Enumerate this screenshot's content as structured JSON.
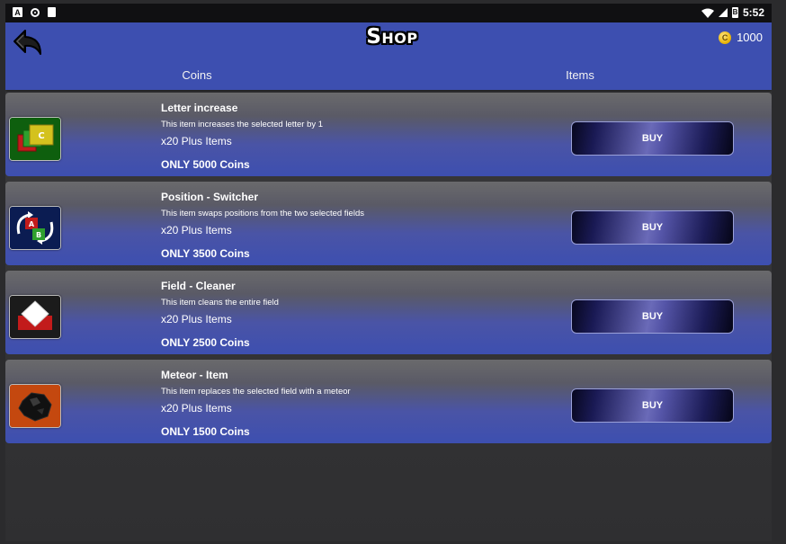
{
  "status_bar": {
    "time": "5:52",
    "notification_a": "A",
    "battery": "B"
  },
  "header": {
    "title": "Shop",
    "coins": "1000",
    "coin_symbol": "C"
  },
  "tabs": [
    {
      "label": "Coins"
    },
    {
      "label": "Items"
    }
  ],
  "items": [
    {
      "title": "Letter increase",
      "description": "This item increases the selected letter by 1",
      "quantity": "x20 Plus Items",
      "price": "ONLY 5000 Coins",
      "buy_label": "BUY",
      "icon": "letter-increase-icon",
      "icon_letter": "C"
    },
    {
      "title": "Position - Switcher",
      "description": "This item swaps positions from the two selected fields",
      "quantity": "x20 Plus Items",
      "price": "ONLY 3500 Coins",
      "buy_label": "BUY",
      "icon": "position-switch-icon",
      "icon_letter_a": "A",
      "icon_letter_b": "B"
    },
    {
      "title": "Field - Cleaner",
      "description": "This item cleans the entire field",
      "quantity": "x20 Plus Items",
      "price": "ONLY 2500 Coins",
      "buy_label": "BUY",
      "icon": "eraser-icon"
    },
    {
      "title": "Meteor - Item",
      "description": "This item replaces the selected field with a meteor",
      "quantity": "x20 Plus Items",
      "price": "ONLY 1500 Coins",
      "buy_label": "BUY",
      "icon": "meteor-icon"
    }
  ],
  "colors": {
    "header_bg": "#3d4fb0",
    "accent_coin": "#e7b100",
    "button_glow": "#6a6ab8"
  }
}
